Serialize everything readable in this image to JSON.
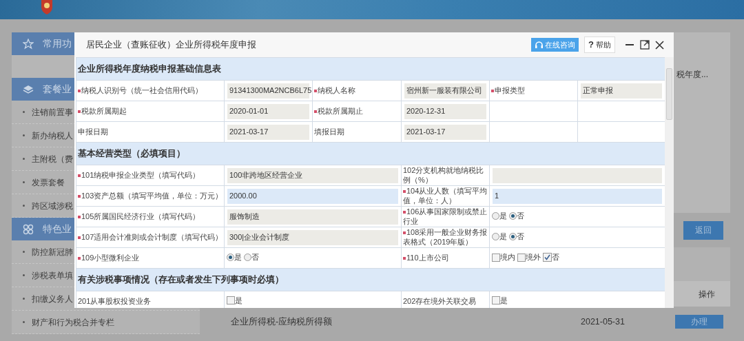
{
  "sidebar": [
    {
      "label": "常用功"
    },
    {
      "label": "套餐业",
      "children": [
        {
          "label": "注销前置事"
        },
        {
          "label": "新办纳税人"
        },
        {
          "label": "主附税（费"
        },
        {
          "label": "发票套餐"
        },
        {
          "label": "跨区域涉税"
        }
      ]
    },
    {
      "label": "特色业",
      "children": [
        {
          "label": "防控新冠肺"
        },
        {
          "label": "涉税表单填"
        },
        {
          "label": "扣缴义务人"
        },
        {
          "label": "财产和行为税合并专栏"
        }
      ]
    }
  ],
  "background": {
    "list_item": "税年度...",
    "return_button": "返回",
    "column_header": "操作",
    "row": {
      "name": "企业所得税-应纳税所得额",
      "date": "2021-05-31",
      "action": "办理"
    }
  },
  "dialog": {
    "title": "居民企业（查账征收）企业所得税年度申报",
    "consult_button": "在线咨询",
    "help_button": {
      "icon": "?",
      "label": "帮助"
    },
    "sections": [
      {
        "title": "企业所得税年度纳税申报基础信息表",
        "rows": [
          {
            "cells": [
              {
                "kind": "label",
                "text": "纳税人识别号（统一社会信用代码）",
                "required": true
              },
              {
                "kind": "value",
                "text": "91341300MA2NCB6L75",
                "editable": false
              },
              {
                "kind": "label",
                "text": "纳税人名称",
                "required": true
              },
              {
                "kind": "value",
                "text": "宿州新一服装有限公司",
                "editable": false
              },
              {
                "kind": "label",
                "text": "申报类型",
                "required": true
              },
              {
                "kind": "value",
                "text": "正常申报",
                "editable": false
              }
            ]
          },
          {
            "cells": [
              {
                "kind": "label",
                "text": "税款所属期起",
                "required": true
              },
              {
                "kind": "value",
                "text": "2020-01-01",
                "editable": false
              },
              {
                "kind": "label",
                "text": "税款所属期止",
                "required": true
              },
              {
                "kind": "value",
                "text": "2020-12-31",
                "editable": false
              },
              {
                "kind": "empty"
              },
              {
                "kind": "empty"
              }
            ]
          },
          {
            "cells": [
              {
                "kind": "label",
                "text": "申报日期",
                "required": false
              },
              {
                "kind": "value",
                "text": "2021-03-17",
                "editable": false
              },
              {
                "kind": "label",
                "text": "填报日期",
                "required": false
              },
              {
                "kind": "value",
                "text": "2021-03-17",
                "editable": false
              },
              {
                "kind": "empty"
              },
              {
                "kind": "empty"
              }
            ]
          }
        ]
      },
      {
        "title": "基本经营类型（必填项目）",
        "rows": [
          {
            "cells": [
              {
                "kind": "label",
                "text": "101纳税申报企业类型（填写代码）",
                "required": true
              },
              {
                "kind": "value",
                "text": "100非跨地区经营企业",
                "editable": false
              },
              {
                "kind": "label",
                "text": "102分支机构就地纳税比例（%）",
                "required": false
              },
              {
                "kind": "value",
                "editable": false
              }
            ]
          },
          {
            "cells": [
              {
                "kind": "label",
                "text": "103资产总额（填写平均值，单位：万元）",
                "required": true
              },
              {
                "kind": "value",
                "text": "2000.00",
                "editable": true
              },
              {
                "kind": "label",
                "text": "104从业人数（填写平均值，单位：人）",
                "required": true
              },
              {
                "kind": "value",
                "text": "1",
                "editable": true
              }
            ]
          },
          {
            "cells": [
              {
                "kind": "label",
                "text": "105所属国民经济行业（填写代码）",
                "required": true
              },
              {
                "kind": "value",
                "text": "服饰制造",
                "editable": false
              },
              {
                "kind": "label",
                "text": "106从事国家限制或禁止行业",
                "required": true
              },
              {
                "kind": "radio",
                "options": [
                  {
                    "label": "是",
                    "selected": false
                  },
                  {
                    "label": "否",
                    "selected": true
                  }
                ]
              }
            ]
          },
          {
            "cells": [
              {
                "kind": "label",
                "text": "107适用会计准则或会计制度（填写代码）",
                "required": true
              },
              {
                "kind": "value",
                "text": "300|企业会计制度",
                "editable": false
              },
              {
                "kind": "label",
                "text": "108采用一般企业财务报表格式（2019年版）",
                "required": true
              },
              {
                "kind": "radio",
                "options": [
                  {
                    "label": "是",
                    "selected": false
                  },
                  {
                    "label": "否",
                    "selected": true
                  }
                ]
              }
            ]
          },
          {
            "cells": [
              {
                "kind": "label",
                "text": "109小型微利企业",
                "required": true
              },
              {
                "kind": "radio",
                "options": [
                  {
                    "label": "是",
                    "selected": true
                  },
                  {
                    "label": "否",
                    "selected": false
                  }
                ]
              },
              {
                "kind": "label",
                "text": "110上市公司",
                "required": true
              },
              {
                "kind": "checkbox",
                "options": [
                  {
                    "label": "境内",
                    "checked": false
                  },
                  {
                    "label": "境外",
                    "checked": false
                  },
                  {
                    "label": "否",
                    "checked": true
                  }
                ]
              }
            ]
          }
        ]
      },
      {
        "title": "有关涉税事项情况（存在或者发生下列事项时必填）",
        "rows": [
          {
            "cells": [
              {
                "kind": "label",
                "text": "201从事股权投资业务",
                "required": false
              },
              {
                "kind": "checkbox",
                "options": [
                  {
                    "label": "是",
                    "checked": false
                  }
                ]
              },
              {
                "kind": "label",
                "text": "202存在境外关联交易",
                "required": false
              },
              {
                "kind": "checkbox",
                "options": [
                  {
                    "label": "是",
                    "checked": false
                  }
                ]
              }
            ]
          }
        ]
      }
    ]
  }
}
